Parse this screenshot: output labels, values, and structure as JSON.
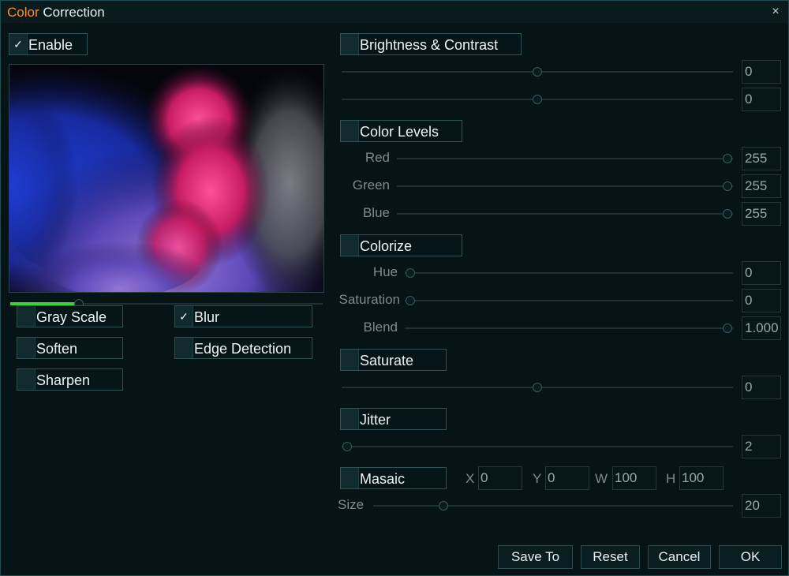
{
  "window": {
    "title_part1": "Color",
    "title_part2": " Correction",
    "close_glyph": "×",
    "title_accent_color": "#ff8a33"
  },
  "left": {
    "enable": {
      "label": "Enable",
      "checked": true
    },
    "preview_slider_fraction": 0.22,
    "filters": {
      "gray_scale": {
        "label": "Gray Scale",
        "checked": false
      },
      "blur": {
        "label": "Blur",
        "checked": true
      },
      "soften": {
        "label": "Soften",
        "checked": false
      },
      "edge_detection": {
        "label": "Edge Detection",
        "checked": false
      },
      "sharpen": {
        "label": "Sharpen",
        "checked": false
      }
    }
  },
  "right": {
    "brightness_contrast": {
      "label": "Brightness & Contrast",
      "checked": false,
      "brightness_value": "0",
      "contrast_value": "0"
    },
    "color_levels": {
      "label": "Color Levels",
      "checked": false,
      "red_label": "Red",
      "red_value": "255",
      "green_label": "Green",
      "green_value": "255",
      "blue_label": "Blue",
      "blue_value": "255"
    },
    "colorize": {
      "label": "Colorize",
      "checked": false,
      "hue_label": "Hue",
      "hue_value": "0",
      "saturation_label": "Saturation",
      "saturation_value": "0",
      "blend_label": "Blend",
      "blend_value": "1.000"
    },
    "saturate": {
      "label": "Saturate",
      "checked": false,
      "value": "0"
    },
    "jitter": {
      "label": "Jitter",
      "checked": false,
      "value": "2"
    },
    "masaic": {
      "label": "Masaic",
      "checked": false,
      "x_label": "X",
      "x_value": "0",
      "y_label": "Y",
      "y_value": "0",
      "w_label": "W",
      "w_value": "100",
      "h_label": "H",
      "h_value": "100",
      "size_label": "Size",
      "size_value": "20"
    }
  },
  "buttons": {
    "save_to": "Save To",
    "reset": "Reset",
    "cancel": "Cancel",
    "ok": "OK"
  }
}
